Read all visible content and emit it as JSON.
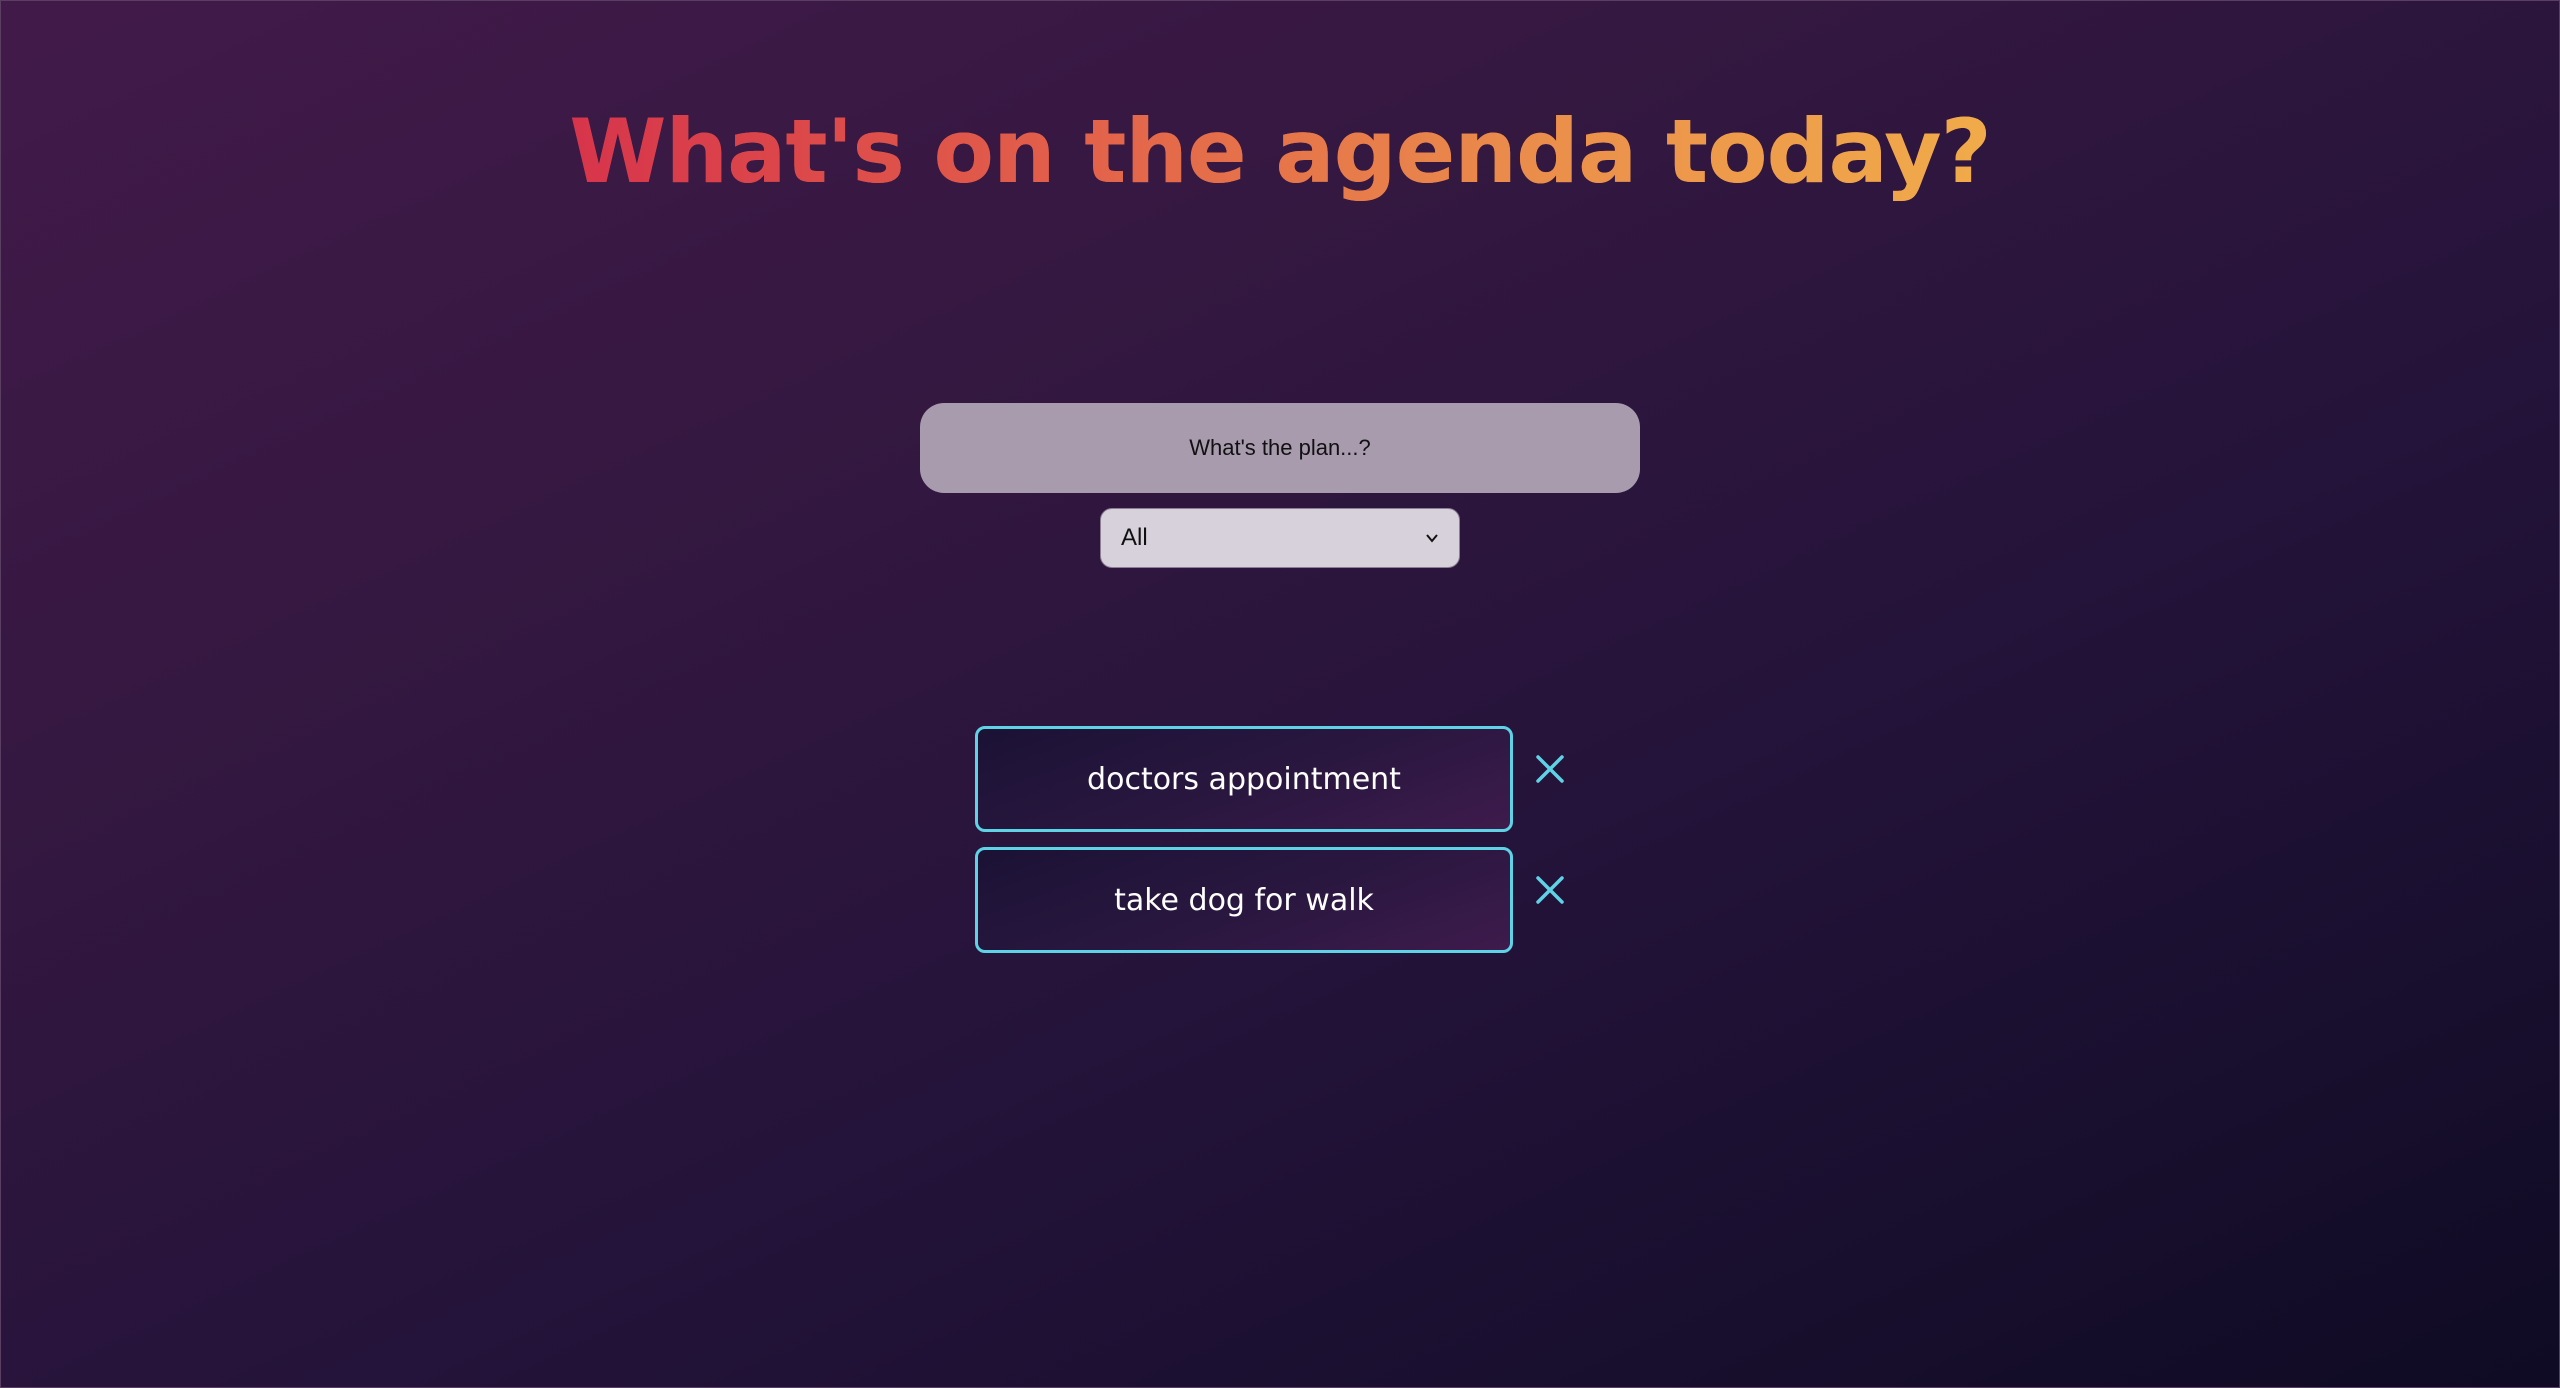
{
  "header": {
    "title": "What's on the agenda today?"
  },
  "form": {
    "input_placeholder": "What's the plan...?",
    "filter_selected": "All"
  },
  "todos": [
    {
      "text": "doctors appointment"
    },
    {
      "text": "take dog for walk"
    }
  ],
  "colors": {
    "title_gradient_start": "#d7344b",
    "title_gradient_end": "#f1ab4a",
    "todo_border": "#5fd3e6",
    "delete_icon": "#5fd3e6",
    "input_bg": "#a89bae",
    "select_bg": "#d7d1dc"
  },
  "icons": {
    "delete": "close-icon",
    "select_arrow": "chevron-down-icon"
  }
}
